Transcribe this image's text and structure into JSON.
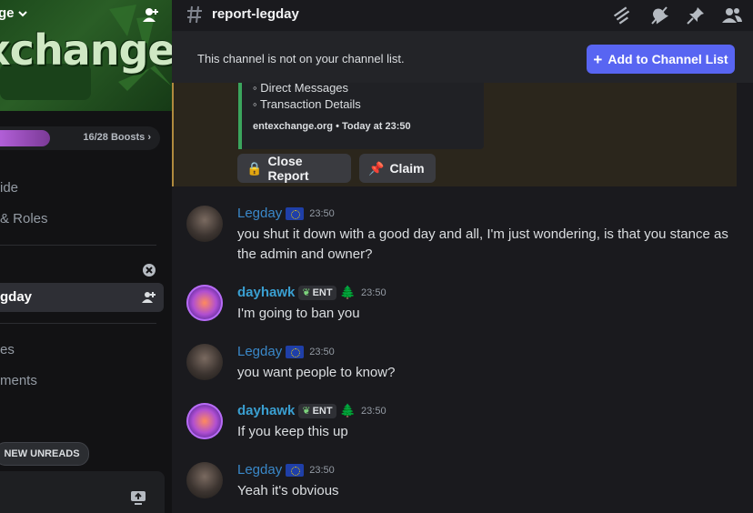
{
  "sidebar": {
    "server_name": "ge",
    "banner_text": "xchange",
    "boosts_label": "16/28 Boosts",
    "boost_progress": 0.571,
    "nav_items": [
      "ide",
      "& Roles"
    ],
    "channel_active": "gday",
    "channels_below": [
      "es",
      "ments"
    ],
    "new_unreads": "NEW UNREADS"
  },
  "header": {
    "channel_name": "report-legday",
    "icons": [
      "threads-icon",
      "mute-icon",
      "pin-icon",
      "members-icon"
    ]
  },
  "notice": {
    "text": "This channel is not on your channel list.",
    "button": "Add to Channel List"
  },
  "embed": {
    "lines": [
      "◦ Direct Messages",
      "◦ Transaction Details"
    ],
    "footer": "entexchange.org • Today at 23:50",
    "buttons": [
      {
        "emoji": "🔒",
        "label": "Close Report"
      },
      {
        "emoji": "📌",
        "label": "Claim"
      }
    ]
  },
  "messages": [
    {
      "author": "Legday",
      "time": "23:50",
      "text": "you shut it down with a good day and all, I'm just wondering, is that you stance as the admin and owner?"
    },
    {
      "author": "dayhawk",
      "tag": "ENT",
      "badge": "🌲",
      "time": "23:50",
      "text": "I'm going to ban you"
    },
    {
      "author": "Legday",
      "time": "23:50",
      "text": "you want people to know?"
    },
    {
      "author": "dayhawk",
      "tag": "ENT",
      "badge": "🌲",
      "time": "23:50",
      "text": "If you keep this up"
    },
    {
      "author": "Legday",
      "time": "23:50",
      "text": "Yeah it's obvious"
    }
  ],
  "colors": {
    "accent": "#5865f2",
    "legday_name": "#3a88c9",
    "dayhawk_name": "#3a9fd1",
    "embed_border": "#3ba55d"
  }
}
